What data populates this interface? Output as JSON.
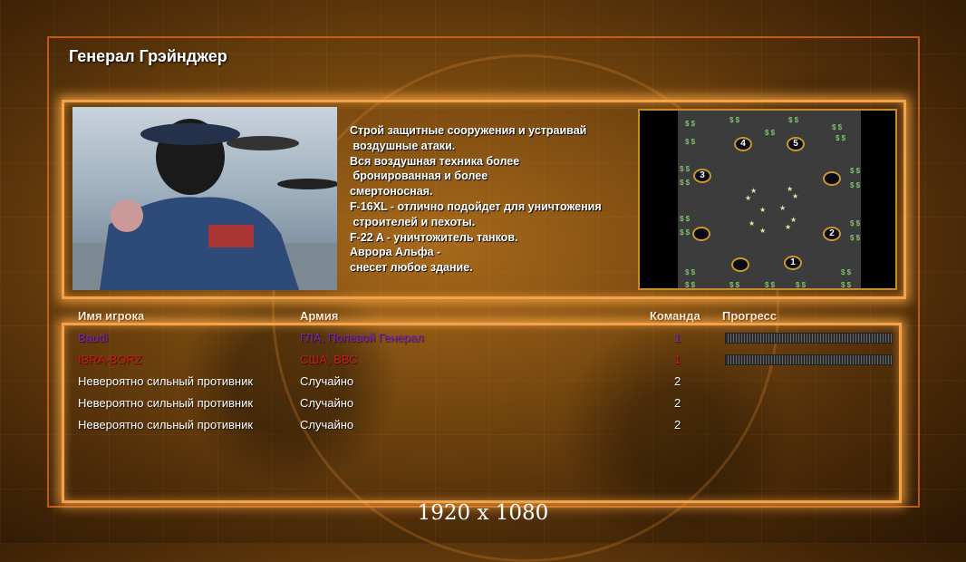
{
  "title": "Генерал Грэйнджер",
  "description": "Строй защитные сооружения и устраивай\n воздушные атаки.\nВся воздушная техника более\n бронированная и более\nсмертоносная.\nF-16XL - отлично подойдет для уничтожения\n строителей и пехоты.\nF-22 A - уничтожитель танков.\nАврора Альфа -\nснесет любое здание.",
  "map": {
    "start_labels": [
      "4",
      "5",
      "3",
      "",
      "",
      "2",
      "",
      "1"
    ]
  },
  "table": {
    "headers": {
      "name": "Имя игрока",
      "army": "Армия",
      "team": "Команда",
      "progress": "Прогресс"
    },
    "rows": [
      {
        "name": "Baudi",
        "army": "ГЛА, Полевой Генерал",
        "team": "1",
        "color": "#7a22c8",
        "progress": 1.0
      },
      {
        "name": "IBRA-BORZ",
        "army": "США, ВВС",
        "team": "1",
        "color": "#d01818",
        "progress": 1.0
      },
      {
        "name": "Невероятно сильный противник",
        "army": "Случайно",
        "team": "2",
        "color": "#ffffff"
      },
      {
        "name": "Невероятно сильный противник",
        "army": "Случайно",
        "team": "2",
        "color": "#ffffff"
      },
      {
        "name": "Невероятно сильный противник",
        "army": "Случайно",
        "team": "2",
        "color": "#ffffff"
      }
    ]
  },
  "resolution": "1920 x 1080"
}
